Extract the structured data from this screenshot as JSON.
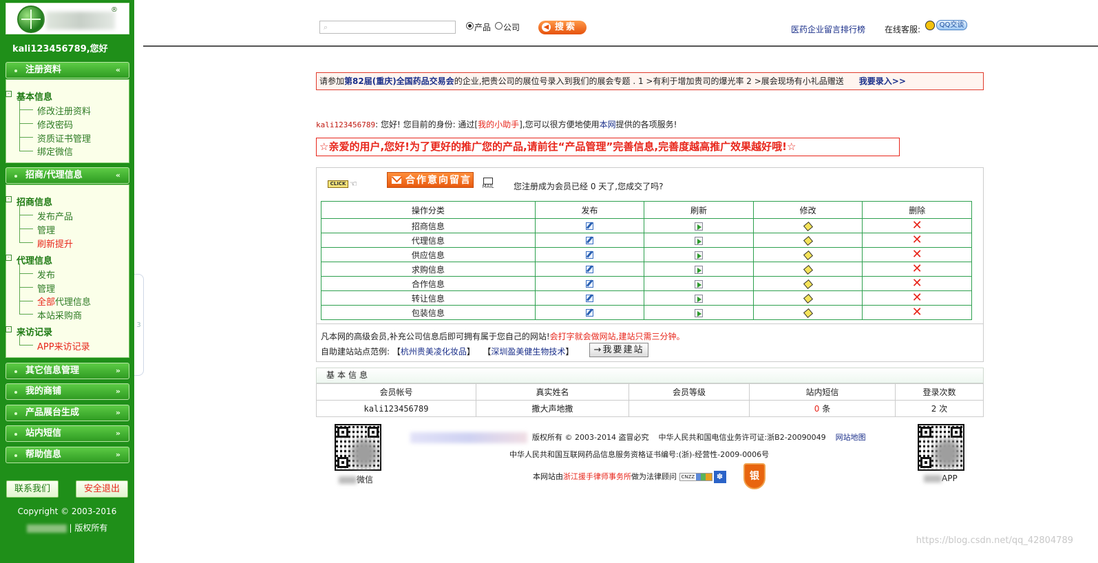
{
  "sidebar": {
    "logo_reg": "®",
    "username": "kali123456789,您好",
    "menus": [
      {
        "label": "注册资料",
        "chevron": "«"
      },
      {
        "label": "招商/代理信息",
        "chevron": "«"
      },
      {
        "label": "其它信息管理",
        "chevron": "»"
      },
      {
        "label": "我的商铺",
        "chevron": "»"
      },
      {
        "label": "产品展台生成",
        "chevron": "»"
      },
      {
        "label": "站内短信",
        "chevron": "»"
      },
      {
        "label": "帮助信息",
        "chevron": "»"
      }
    ],
    "registration": {
      "group": "基本信息",
      "items": [
        "修改注册资料",
        "修改密码",
        "资质证书管理",
        "绑定微信"
      ]
    },
    "agency": {
      "group1": "招商信息",
      "group1_items": [
        "发布产品",
        "管理",
        "刷新提升"
      ],
      "group2": "代理信息",
      "group2_items": [
        "发布",
        "管理"
      ],
      "group2_all_red": "全部",
      "group2_all_rest": "代理信息",
      "group2_local": "本站采购商",
      "group3": "来访记录",
      "group3_items": [
        "APP来访记录"
      ]
    },
    "contact_label": "联系我们",
    "logout_label": "安全退出",
    "copyright": "Copyright © 2003-2016",
    "rights": "| 版权所有",
    "collapse_tab": "3"
  },
  "topbar": {
    "search_placeholder": "",
    "radio_product": "产品",
    "radio_company": "公司",
    "search_label": "搜索",
    "rank_link": "医药企业留言排行榜",
    "service_label": "在线客服:",
    "qq_label": "QQ交谈"
  },
  "notice": {
    "pre": "请参加",
    "fair": "第82届(重庆)全国药品交易会",
    "post": "的企业,把贵公司的展位号录入到我们的展会专题 . 1 >有利于增加贵司的爆光率  2 >展会现场有小礼品赠送",
    "enter": "我要录入>>"
  },
  "greeting": {
    "user": "kali123456789",
    "part1": ": 您好! 您目前的身份:   通过[",
    "helper": "我的小助手",
    "part2": "],您可以很方便地使用",
    "site": "本网",
    "part3": "提供的各项服务!"
  },
  "promo": "☆亲爱的用户,您好!为了更好的推广您的产品,请前往“产品管理”完善信息,完善度越高推广效果越好哦!☆",
  "panel": {
    "click_text": "CLICK",
    "coop_label": "合作意向留言",
    "mail_text": "MAIL",
    "reg_days_pre": "您注册成为会员已经 ",
    "reg_days_value": "0",
    "reg_days_post": " 天了,您成交了吗?",
    "headers": [
      "操作分类",
      "发布",
      "刷新",
      "修改",
      "删除"
    ],
    "rows": [
      "招商信息",
      "代理信息",
      "供应信息",
      "求购信息",
      "合作信息",
      "转让信息",
      "包装信息"
    ],
    "advanced_pre": "凡本网的高级会员,补充公司信息后即可拥有属于您自己的网站!",
    "advanced_red": "会打字就会做网站,建站只需三分钟。",
    "example_pre": "自助建站站点范例:",
    "example1": "杭州贵美凌化妆品",
    "example2": "深圳盈美健生物技术",
    "build_label": "→我要建站"
  },
  "basic_info": {
    "title": "基本信息",
    "headers": [
      "会员帐号",
      "真实姓名",
      "会员等级",
      "站内短信",
      "登录次数"
    ],
    "account": "kali123456789",
    "real_name": "撒大声地撒",
    "level": "",
    "messages_value": "0",
    "messages_unit": " 条",
    "login_count": "2 次"
  },
  "footer": {
    "line1_rights": "版权所有 © 2003-2014 盗冒必究",
    "line1_icp": "中华人民共和国电信业务许可证:浙B2-20090049",
    "sitemap": "网站地图",
    "line2": "中华人民共和国互联网药品信息服务资格证书编号:(浙)-经营性-2009-0006号",
    "line3_pre": "本网站由",
    "law_firm": "浙江援手律师事务所",
    "line3_post": "做为法律顾问",
    "cnzz": "CNZZ",
    "shield_char": "银",
    "qr_left_label": "微信",
    "qr_right_label": "APP"
  },
  "watermark": "https://blog.csdn.net/qq_42804789"
}
